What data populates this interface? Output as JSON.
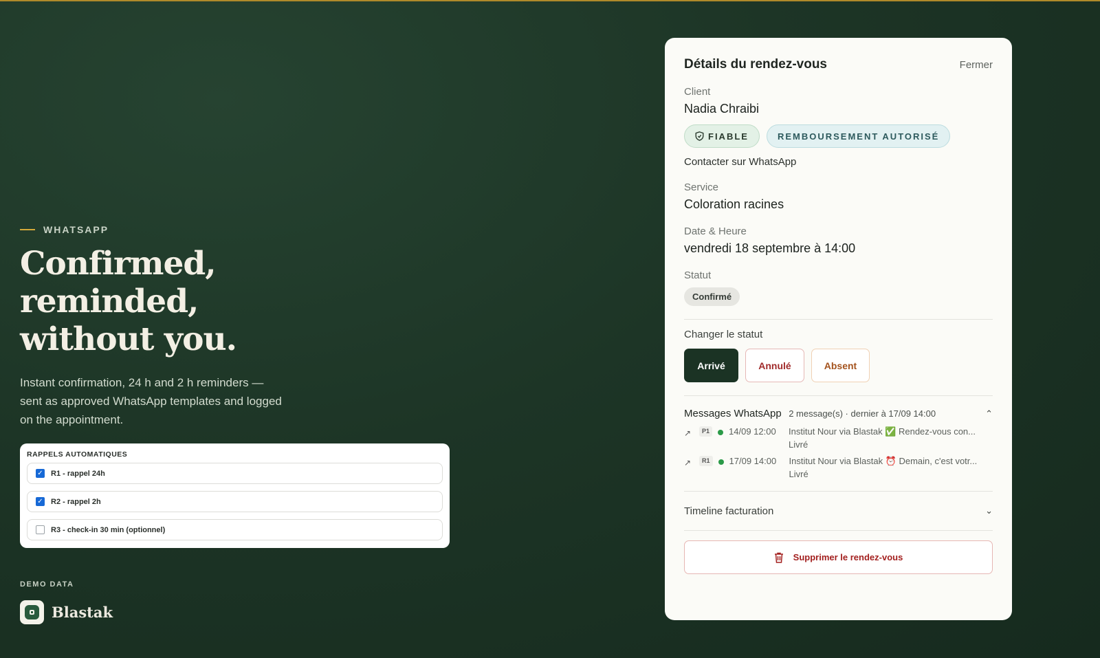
{
  "hero": {
    "eyebrow": "WHATSAPP",
    "headline": "Confirmed, reminded, without you.",
    "lead": "Instant confirmation, 24 h and 2 h reminders — sent as approved WhatsApp templates and logged on the appointment."
  },
  "rappels": {
    "title": "RAPPELS AUTOMATIQUES",
    "items": [
      {
        "label": "R1 - rappel 24h",
        "checked": true
      },
      {
        "label": "R2 - rappel 2h",
        "checked": true
      },
      {
        "label": "R3 - check-in 30 min (optionnel)",
        "checked": false
      }
    ]
  },
  "footer": {
    "demo_label": "DEMO DATA",
    "brand": "Blastak"
  },
  "panel": {
    "title": "Détails du rendez-vous",
    "close": "Fermer",
    "client_label": "Client",
    "client_name": "Nadia Chraibi",
    "badge_fiable": "FIABLE",
    "badge_remb": "REMBOURSEMENT AUTORISÉ",
    "contact": "Contacter sur WhatsApp",
    "service_label": "Service",
    "service_value": "Coloration racines",
    "date_label": "Date & Heure",
    "date_value": "vendredi 18 septembre à 14:00",
    "statut_label": "Statut",
    "statut_value": "Confirmé",
    "change_label": "Changer le statut",
    "btn_arrive": "Arrivé",
    "btn_annule": "Annulé",
    "btn_absent": "Absent",
    "messages_title": "Messages WhatsApp",
    "messages_meta": "2 message(s) · dernier à 17/09 14:00",
    "messages": [
      {
        "tag": "P1",
        "time": "14/09 12:00",
        "text": "Institut Nour via Blastak ✅ Rendez-vous con...",
        "status": "Livré"
      },
      {
        "tag": "R1",
        "time": "17/09 14:00",
        "text": "Institut Nour via Blastak ⏰ Demain, c'est votr...",
        "status": "Livré"
      }
    ],
    "timeline": "Timeline facturation",
    "delete": "Supprimer le rendez-vous"
  },
  "colors": {
    "background": "#1d3526",
    "accent": "#d4a93a",
    "primary_button": "#1b3324",
    "danger": "#a3201f"
  },
  "icons": [
    "shield-icon",
    "arrow-outgoing-icon",
    "chevron-up-icon",
    "chevron-down-icon",
    "trash-icon",
    "checkbox-icon",
    "brand-logo-icon"
  ]
}
